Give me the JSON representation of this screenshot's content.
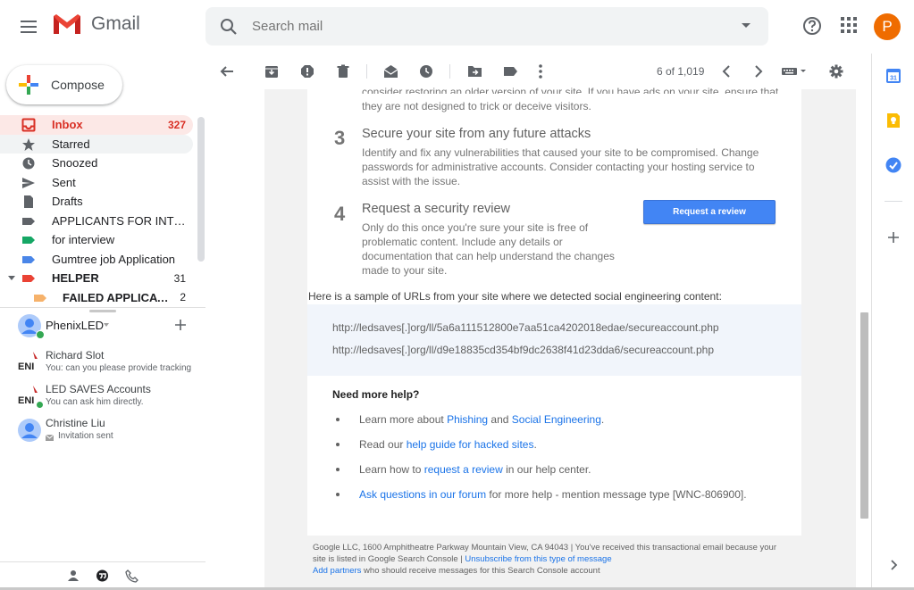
{
  "app": {
    "name": "Gmail"
  },
  "search": {
    "placeholder": "Search mail"
  },
  "account": {
    "initial": "P"
  },
  "compose": {
    "label": "Compose"
  },
  "nav": [
    {
      "label": "Inbox",
      "count": "327",
      "icon": "inbox-icon"
    },
    {
      "label": "Starred",
      "count": "",
      "icon": "star-icon"
    },
    {
      "label": "Snoozed",
      "count": "",
      "icon": "clock-icon"
    },
    {
      "label": "Sent",
      "count": "",
      "icon": "send-icon"
    },
    {
      "label": "Drafts",
      "count": "",
      "icon": "draft-icon"
    },
    {
      "label": "APPLICANTS FOR INTER...",
      "count": "",
      "icon": "label-icon"
    },
    {
      "label": "for interview",
      "count": "",
      "icon": "label-icon"
    },
    {
      "label": "Gumtree job Application",
      "count": "",
      "icon": "label-icon"
    },
    {
      "label": "HELPER",
      "count": "31",
      "icon": "label-icon"
    },
    {
      "label": "FAILED APPLICATI...",
      "count": "2",
      "icon": "label-icon"
    }
  ],
  "hangouts": {
    "me": "PhenixLED",
    "contacts": [
      {
        "name": "Richard Slot",
        "message": "You: can you please provide tracking n"
      },
      {
        "name": "LED SAVES Accounts",
        "message": "You can ask him directly."
      },
      {
        "name": "Christine Liu",
        "message": "Invitation sent"
      }
    ]
  },
  "toolbar": {
    "pager": "6 of 1,019"
  },
  "email": {
    "intro_tail_1": "consider restoring an older version of your site. If you have ads on your site, ensure that",
    "intro_tail_2": "they are not designed to trick or deceive visitors.",
    "steps": [
      {
        "num": "3",
        "title": "Secure your site from any future attacks",
        "lines": [
          "Identify and fix any vulnerabilities that caused your site to be compromised. Change",
          "passwords for administrative accounts. Consider contacting your hosting service to",
          "assist with the issue."
        ]
      },
      {
        "num": "4",
        "title": "Request a security review",
        "lines": [
          "Only do this once you're sure your site is free of",
          "problematic content. Include any details or",
          "documentation that can help understand the changes",
          "made to your site."
        ]
      }
    ],
    "review_button": "Request a review",
    "sample_intro": "Here is a sample of URLs from your site where we detected social engineering content:",
    "urls": [
      "http://ledsaves[.]org/ll/5a6a111512800e7aa51ca4202018edae/secureaccount.php",
      "http://ledsaves[.]org/ll/d9e18835cd354bf9dc2638f41d23dda6/secureaccount.php"
    ],
    "help": {
      "title": "Need more help?",
      "item1": {
        "pre": "Learn more about ",
        "link1": "Phishing",
        "mid": " and ",
        "link2": "Social Engineering",
        "post": "."
      },
      "item2": {
        "pre": "Read our ",
        "link": "help guide for hacked sites",
        "post": "."
      },
      "item3": {
        "pre": "Learn how to ",
        "link": "request a review",
        "post": " in our help center."
      },
      "item4": {
        "link": "Ask questions in our forum",
        "post": " for more help - mention message type [WNC-806900]."
      }
    },
    "footer": {
      "line1": "Google LLC, 1600 Amphitheatre Parkway Mountain View, CA 94043 | You've received this transactional email because your",
      "line2_pre": "site is listed in Google Search Console | ",
      "unsubscribe": "Unsubscribe from this type of message",
      "add_partners": "Add partners",
      "line3_post": " who should receive messages for this Search Console account"
    }
  },
  "colors": {
    "accent": "#1a73e8",
    "inbox_active": "#d93025",
    "button": "#4285f4",
    "avatar": "#ef6c00"
  }
}
